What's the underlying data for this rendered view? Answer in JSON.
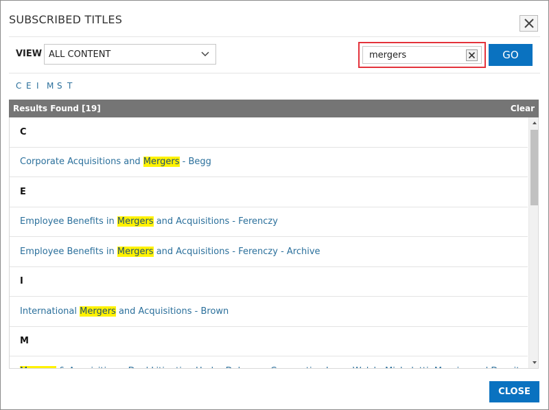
{
  "dialog": {
    "title": "SUBSCRIBED TITLES",
    "close_label": "CLOSE"
  },
  "filter": {
    "view_label": "VIEW",
    "view_selected": "ALL CONTENT",
    "search_value": "mergers",
    "go_label": "GO"
  },
  "alphabet": [
    "C",
    "E",
    "I",
    "M",
    "S",
    "T"
  ],
  "results": {
    "found_label": "Results Found [19]",
    "clear_label": "Clear"
  },
  "list": [
    {
      "type": "header",
      "text": "C"
    },
    {
      "type": "item",
      "before": "Corporate Acquisitions and ",
      "match": "Mergers",
      "after": " - Begg"
    },
    {
      "type": "header",
      "text": "E"
    },
    {
      "type": "item",
      "before": "Employee Benefits in ",
      "match": "Mergers",
      "after": " and Acquisitions - Ferenczy"
    },
    {
      "type": "item",
      "before": "Employee Benefits in ",
      "match": "Mergers",
      "after": " and Acquisitions - Ferenczy - Archive"
    },
    {
      "type": "header",
      "text": "I"
    },
    {
      "type": "item",
      "before": "International ",
      "match": "Mergers",
      "after": " and Acquisitions - Brown"
    },
    {
      "type": "header",
      "text": "M"
    },
    {
      "type": "item",
      "before": "",
      "match": "Mergers",
      "after": " & Acquisitions: Deal Litigation Under Delaware Corporation Law - Welch, Michelotti, Mourier and Dunsitz"
    }
  ],
  "colors": {
    "accent": "#0a72c0",
    "highlight": "#fff200",
    "link": "#2a6f9b",
    "search_focus_border": "#e3313a",
    "results_bar": "#757575"
  }
}
